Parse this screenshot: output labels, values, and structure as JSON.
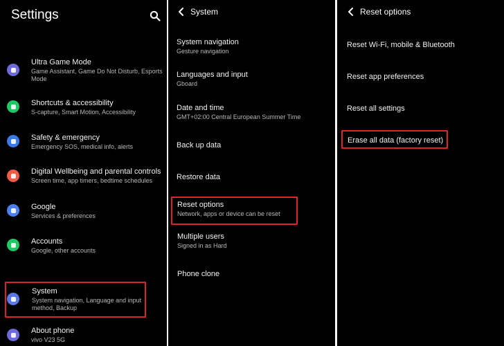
{
  "settings": {
    "title": "Settings",
    "items": [
      {
        "title": "Ultra Game Mode",
        "subtitle": "Game Assistant, Game Do Not Disturb, Esports Mode",
        "icon": "gamepad-icon",
        "color": "#6e6ad9"
      },
      {
        "title": "Shortcuts & accessibility",
        "subtitle": "S-capture, Smart Motion, Accessibility",
        "icon": "accessibility-icon",
        "color": "#1ec864"
      },
      {
        "title": "Safety & emergency",
        "subtitle": "Emergency SOS, medical info, alerts",
        "icon": "shield-icon",
        "color": "#3c78e6"
      },
      {
        "title": "Digital Wellbeing and parental controls",
        "subtitle": "Screen time, app timers, bedtime schedules",
        "icon": "wellbeing-icon",
        "color": "#f05a46"
      },
      {
        "title": "Google",
        "subtitle": "Services & preferences",
        "icon": "google-icon",
        "color": "#4c7ff0"
      },
      {
        "title": "Accounts",
        "subtitle": "Google, other accounts",
        "icon": "accounts-icon",
        "color": "#1ec864"
      },
      {
        "title": "System",
        "subtitle": "System navigation, Language and input method, Backup",
        "icon": "system-icon",
        "color": "#5a78e6"
      },
      {
        "title": "About phone",
        "subtitle": "vivo V23 5G",
        "icon": "phone-icon",
        "color": "#6e6ad9"
      }
    ]
  },
  "system": {
    "title": "System",
    "items": [
      {
        "title": "System navigation",
        "subtitle": "Gesture navigation"
      },
      {
        "title": "Languages and input",
        "subtitle": "Gboard"
      },
      {
        "title": "Date and time",
        "subtitle": "GMT+02:00 Central European Summer Time"
      },
      {
        "title": "Back up data",
        "subtitle": ""
      },
      {
        "title": "Restore data",
        "subtitle": ""
      },
      {
        "title": "Reset options",
        "subtitle": "Network, apps or device can be reset"
      },
      {
        "title": "Multiple users",
        "subtitle": "Signed in as Hard"
      },
      {
        "title": "Phone clone",
        "subtitle": ""
      }
    ]
  },
  "reset": {
    "title": "Reset options",
    "items": [
      {
        "title": "Reset Wi-Fi, mobile & Bluetooth"
      },
      {
        "title": "Reset app preferences"
      },
      {
        "title": "Reset all settings"
      },
      {
        "title": "Erase all data (factory reset)"
      }
    ]
  },
  "colors": {
    "highlight": "#e0242e",
    "background": "#000000"
  }
}
